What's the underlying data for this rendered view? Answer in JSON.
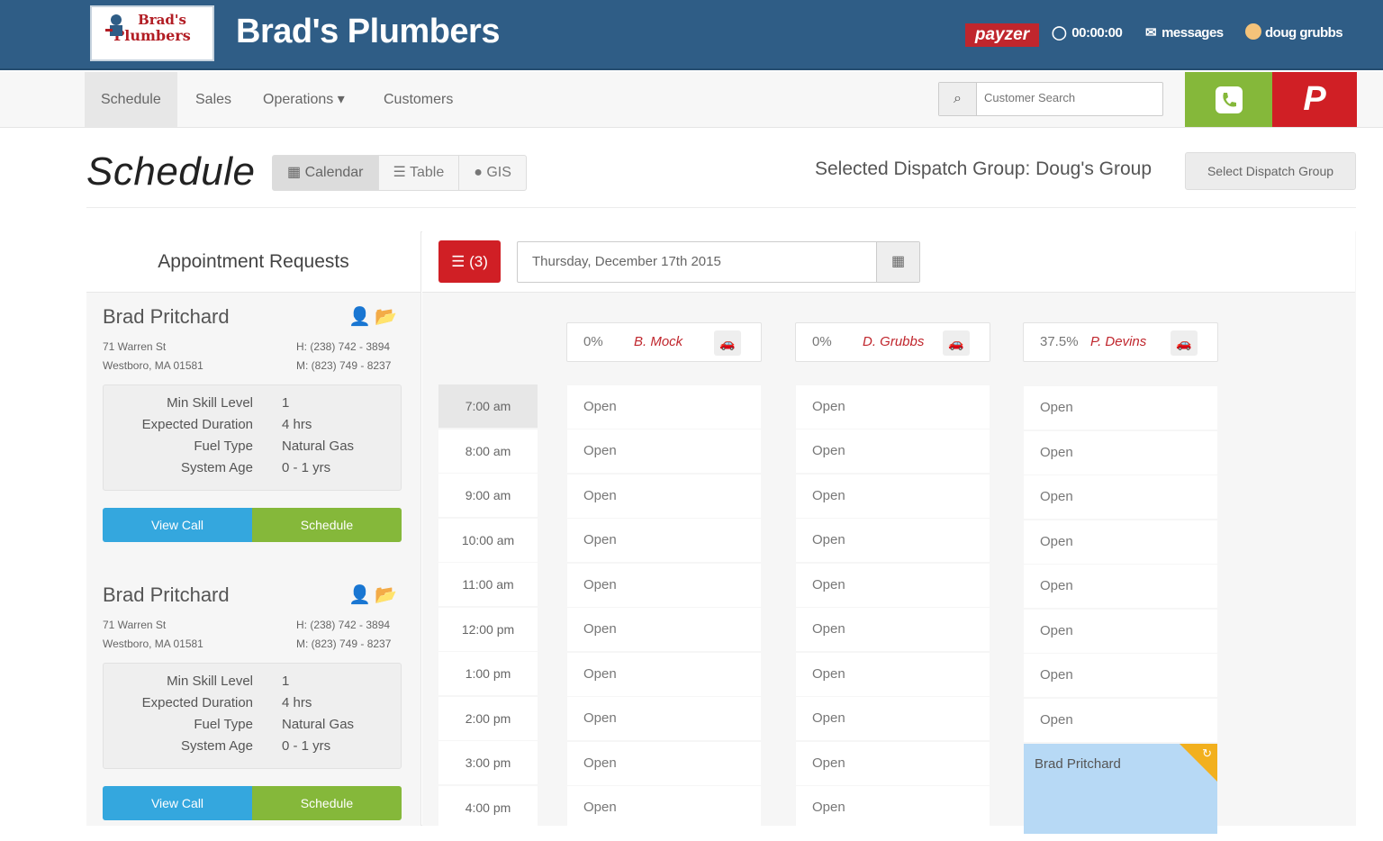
{
  "header": {
    "logo_line1": "Brad's",
    "logo_line2": "Plumbers",
    "brand": "Brad's Plumbers",
    "payzer": "payzer",
    "timer": "00:00:00",
    "messages": "messages",
    "user": "doug grubbs"
  },
  "nav": {
    "items": [
      "Schedule",
      "Sales",
      "Operations ▾",
      "Customers"
    ],
    "search_placeholder": "Customer Search",
    "p_label": "P"
  },
  "page": {
    "title": "Schedule",
    "views": [
      "Calendar",
      "Table",
      "GIS"
    ],
    "dispatch_label": "Selected Dispatch Group: Doug's Group",
    "dispatch_button": "Select Dispatch Group"
  },
  "requests": {
    "header": "Appointment Requests",
    "cards": [
      {
        "name": "Brad Pritchard",
        "address1": "71 Warren St",
        "address2": "Westboro, MA 01581",
        "phone1": "H: (238) 742 - 3894",
        "phone2": "M: (823) 749 - 8237",
        "details": [
          {
            "k": "Min Skill Level",
            "v": "1"
          },
          {
            "k": "Expected Duration",
            "v": "4 hrs"
          },
          {
            "k": "Fuel Type",
            "v": "Natural Gas"
          },
          {
            "k": "System Age",
            "v": "0 - 1 yrs"
          }
        ],
        "view_label": "View Call",
        "schedule_label": "Schedule"
      },
      {
        "name": "Brad Pritchard",
        "address1": "71 Warren St",
        "address2": "Westboro, MA 01581",
        "phone1": "H: (238) 742 - 3894",
        "phone2": "M: (823) 749 - 8237",
        "details": [
          {
            "k": "Min Skill Level",
            "v": "1"
          },
          {
            "k": "Expected Duration",
            "v": "4 hrs"
          },
          {
            "k": "Fuel Type",
            "v": "Natural Gas"
          },
          {
            "k": "System Age",
            "v": "0 - 1 yrs"
          }
        ],
        "view_label": "View Call",
        "schedule_label": "Schedule"
      }
    ]
  },
  "calendar": {
    "list_badge": "(3)",
    "date": "Thursday, December 17th 2015",
    "techs": [
      {
        "pct": "0%",
        "name": "B. Mock"
      },
      {
        "pct": "0%",
        "name": "D. Grubbs"
      },
      {
        "pct": "37.5%",
        "name": "P. Devins"
      }
    ],
    "times": [
      "7:00 am",
      "8:00 am",
      "9:00 am",
      "10:00 am",
      "11:00 am",
      "12:00 pm",
      "1:00 pm",
      "2:00 pm",
      "3:00 pm",
      "4:00 pm"
    ],
    "slot_label": "Open",
    "appointment": "Brad Pritchard"
  },
  "colors": {
    "brand_blue": "#2f5d86",
    "red": "#d01f25",
    "green": "#85b83a",
    "blue": "#34a7de",
    "appt_blue": "#b7d9f5",
    "appt_corner": "#f2b01e"
  }
}
